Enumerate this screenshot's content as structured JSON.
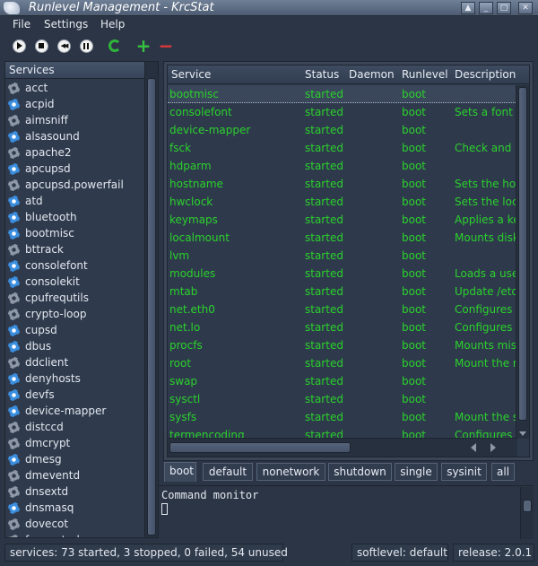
{
  "window": {
    "title": "Runlevel Management - KrcStat",
    "buttons": {
      "shade": "▲",
      "minimize": "_",
      "maximize": "□",
      "close": "✕"
    }
  },
  "menu": [
    "File",
    "Settings",
    "Help"
  ],
  "toolbar": {
    "icons": [
      "play-icon",
      "stop-icon",
      "rewind-icon",
      "pause-icon",
      "refresh-icon",
      "add-icon",
      "remove-icon"
    ],
    "plus": "+",
    "minus": "−",
    "rewind": "◀◀"
  },
  "services_panel": {
    "header": "Services",
    "items": [
      {
        "label": "acct",
        "icon": "gray"
      },
      {
        "label": "acpid",
        "icon": "blue"
      },
      {
        "label": "aimsniff",
        "icon": "gray"
      },
      {
        "label": "alsasound",
        "icon": "blue"
      },
      {
        "label": "apache2",
        "icon": "gray"
      },
      {
        "label": "apcupsd",
        "icon": "blue"
      },
      {
        "label": "apcupsd.powerfail",
        "icon": "gray"
      },
      {
        "label": "atd",
        "icon": "blue"
      },
      {
        "label": "bluetooth",
        "icon": "blue"
      },
      {
        "label": "bootmisc",
        "icon": "blue"
      },
      {
        "label": "bttrack",
        "icon": "gray"
      },
      {
        "label": "consolefont",
        "icon": "blue"
      },
      {
        "label": "consolekit",
        "icon": "blue"
      },
      {
        "label": "cpufrequtils",
        "icon": "gray"
      },
      {
        "label": "crypto-loop",
        "icon": "gray"
      },
      {
        "label": "cupsd",
        "icon": "blue"
      },
      {
        "label": "dbus",
        "icon": "blue"
      },
      {
        "label": "ddclient",
        "icon": "gray"
      },
      {
        "label": "denyhosts",
        "icon": "blue"
      },
      {
        "label": "devfs",
        "icon": "blue"
      },
      {
        "label": "device-mapper",
        "icon": "blue"
      },
      {
        "label": "distccd",
        "icon": "gray"
      },
      {
        "label": "dmcrypt",
        "icon": "gray"
      },
      {
        "label": "dmesg",
        "icon": "blue"
      },
      {
        "label": "dmeventd",
        "icon": "gray"
      },
      {
        "label": "dnsextd",
        "icon": "gray"
      },
      {
        "label": "dnsmasq",
        "icon": "blue"
      },
      {
        "label": "dovecot",
        "icon": "gray"
      },
      {
        "label": "fancontrol",
        "icon": "gray"
      }
    ]
  },
  "table": {
    "columns": [
      "Service",
      "Status",
      "Daemon",
      "Runlevel",
      "Description"
    ],
    "rows": [
      [
        "bootmisc",
        "started",
        "",
        "boot",
        ""
      ],
      [
        "consolefont",
        "started",
        "",
        "boot",
        "Sets a font"
      ],
      [
        "device-mapper",
        "started",
        "",
        "boot",
        ""
      ],
      [
        "fsck",
        "started",
        "",
        "boot",
        "Check and r"
      ],
      [
        "hdparm",
        "started",
        "",
        "boot",
        ""
      ],
      [
        "hostname",
        "started",
        "",
        "boot",
        "Sets the hos"
      ],
      [
        "hwclock",
        "started",
        "",
        "boot",
        "Sets the loc"
      ],
      [
        "keymaps",
        "started",
        "",
        "boot",
        "Applies a ke"
      ],
      [
        "localmount",
        "started",
        "",
        "boot",
        "Mounts disk"
      ],
      [
        "lvm",
        "started",
        "",
        "boot",
        ""
      ],
      [
        "modules",
        "started",
        "",
        "boot",
        "Loads a use"
      ],
      [
        "mtab",
        "started",
        "",
        "boot",
        "Update /etc/"
      ],
      [
        "net.eth0",
        "started",
        "",
        "boot",
        "Configures n"
      ],
      [
        "net.lo",
        "started",
        "",
        "boot",
        "Configures n"
      ],
      [
        "procfs",
        "started",
        "",
        "boot",
        "Mounts misc"
      ],
      [
        "root",
        "started",
        "",
        "boot",
        "Mount the ro"
      ],
      [
        "swap",
        "started",
        "",
        "boot",
        ""
      ],
      [
        "sysctl",
        "started",
        "",
        "boot",
        ""
      ],
      [
        "sysfs",
        "started",
        "",
        "boot",
        "Mount the sy"
      ],
      [
        "termencoding",
        "started",
        "",
        "boot",
        "Configures t"
      ]
    ],
    "selected_row": 0
  },
  "tabs": {
    "items": [
      "boot",
      "default",
      "nonetwork",
      "shutdown",
      "single",
      "sysinit",
      "all"
    ],
    "active": 0
  },
  "command_monitor": {
    "text": "Command monitor"
  },
  "statusbar": {
    "services": "services: 73 started, 3 stopped, 0 failed, 54 unused",
    "softlevel": "softlevel: default",
    "release": "release: 2.0.1"
  },
  "colors": {
    "background": "#2b3545",
    "started_text": "#2bd12b",
    "icon_running": "#3b8fe0",
    "icon_idle": "#8e98a6"
  }
}
